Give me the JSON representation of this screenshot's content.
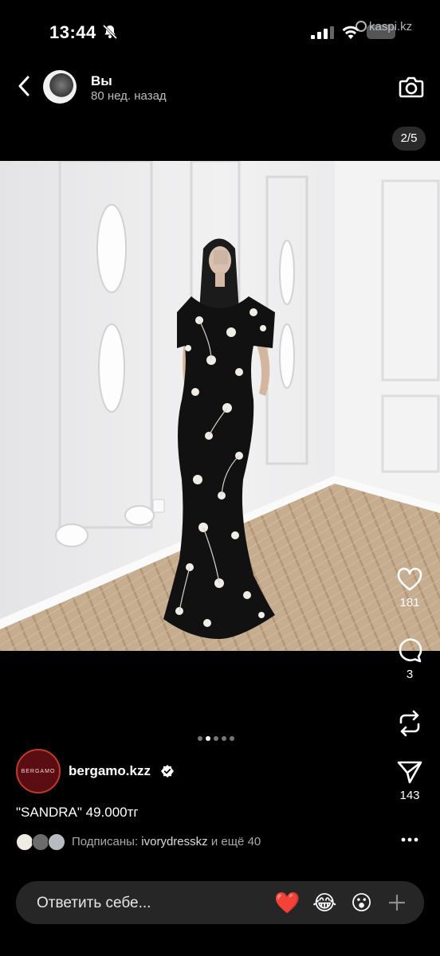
{
  "status_bar": {
    "time": "13:44",
    "watermark": "kaspi.kz"
  },
  "story": {
    "user_name": "Вы",
    "post_time": "80 нед. назад",
    "page_indicator": "2/5"
  },
  "actions": {
    "likes": "181",
    "comments": "3",
    "shares": "143"
  },
  "carousel": {
    "total": 5,
    "active_index": 1
  },
  "author": {
    "logo_text": "BERGAMO",
    "name": "bergamo.kzz",
    "caption": "\"SANDRA\" 49.000тг",
    "followers_label": "Подписаны:",
    "followers_user": "ivorydresskz",
    "followers_more": "и ещё 40"
  },
  "reply": {
    "placeholder": "Ответить себе...",
    "reactions": [
      "❤️",
      "😂",
      "😮"
    ]
  },
  "colors": {
    "background": "#000000",
    "reply_bar": "#262626",
    "brand_ring": "#c0392b"
  }
}
